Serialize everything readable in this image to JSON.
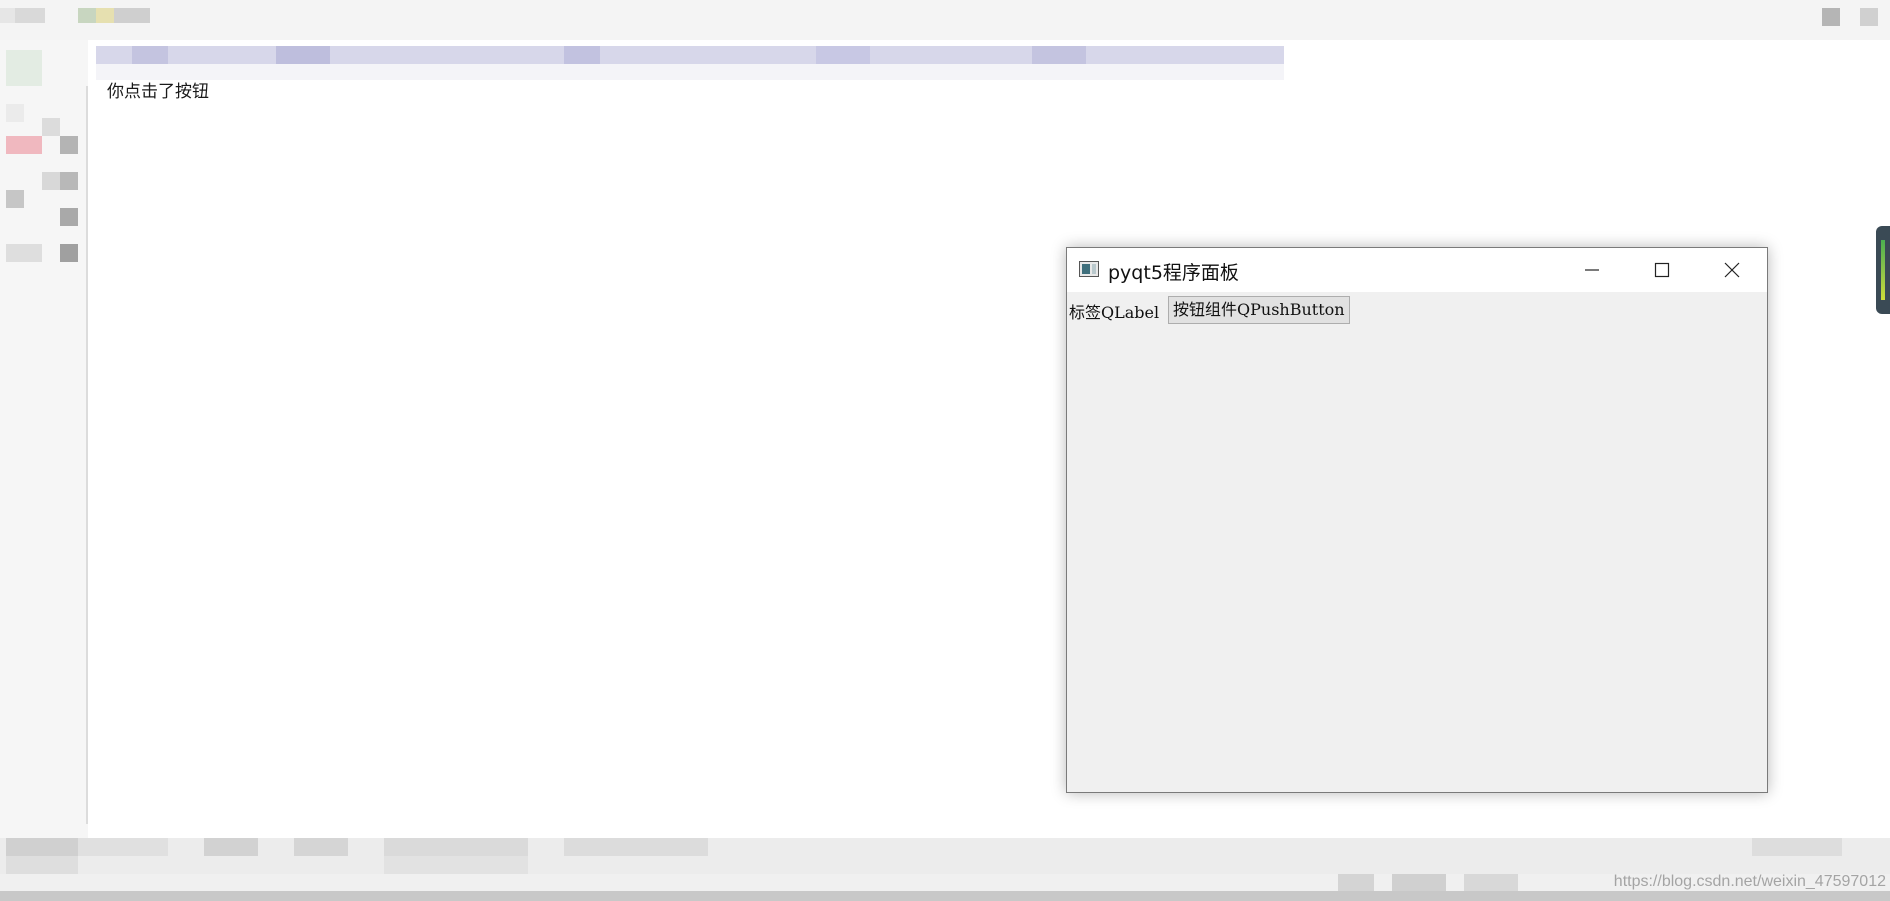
{
  "console": {
    "output_text": "你点击了按钮"
  },
  "app_window": {
    "title": "pyqt5程序面板",
    "icon": "python-app-icon",
    "controls": {
      "minimize": "minimize-icon",
      "maximize": "maximize-icon",
      "close": "close-icon"
    },
    "label_text": "标签QLabel",
    "button_text": "按钮组件QPushButton"
  },
  "watermark": {
    "text": "https://blog.csdn.net/weixin_47597012"
  },
  "colors": {
    "window_bg": "#f0f0f0",
    "titlebar_bg": "#ffffff",
    "button_bg": "#e1e1e1",
    "button_border": "#adadad",
    "editor_bg": "#ffffff"
  }
}
